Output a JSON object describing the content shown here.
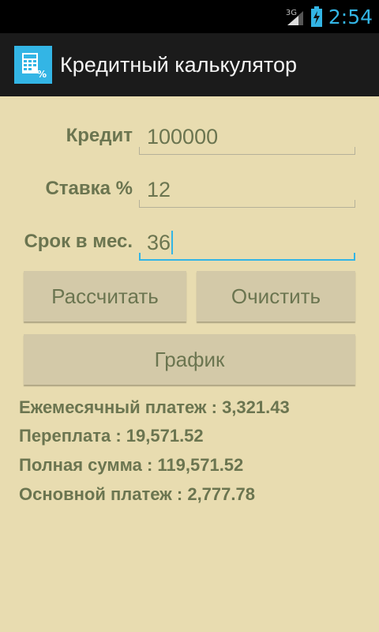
{
  "status_bar": {
    "network": "3G",
    "time": "2:54",
    "accent_color": "#33b5e5"
  },
  "action_bar": {
    "title": "Кредитный калькулятор",
    "icon": "calculator-percent-icon"
  },
  "form": {
    "credit_label": "Кредит",
    "credit_value": "100000",
    "rate_label": "Ставка %",
    "rate_value": "12",
    "term_label": "Срок в мес.",
    "term_value": "36"
  },
  "buttons": {
    "calculate": "Рассчитать",
    "clear": "Очистить",
    "schedule": "График"
  },
  "results": {
    "monthly_payment": "Ежемесячный платеж : 3,321.43",
    "overpayment": "Переплата : 19,571.52",
    "total_amount": "Полная сумма : 119,571.52",
    "principal_payment": "Основной платеж : 2,777.78"
  }
}
